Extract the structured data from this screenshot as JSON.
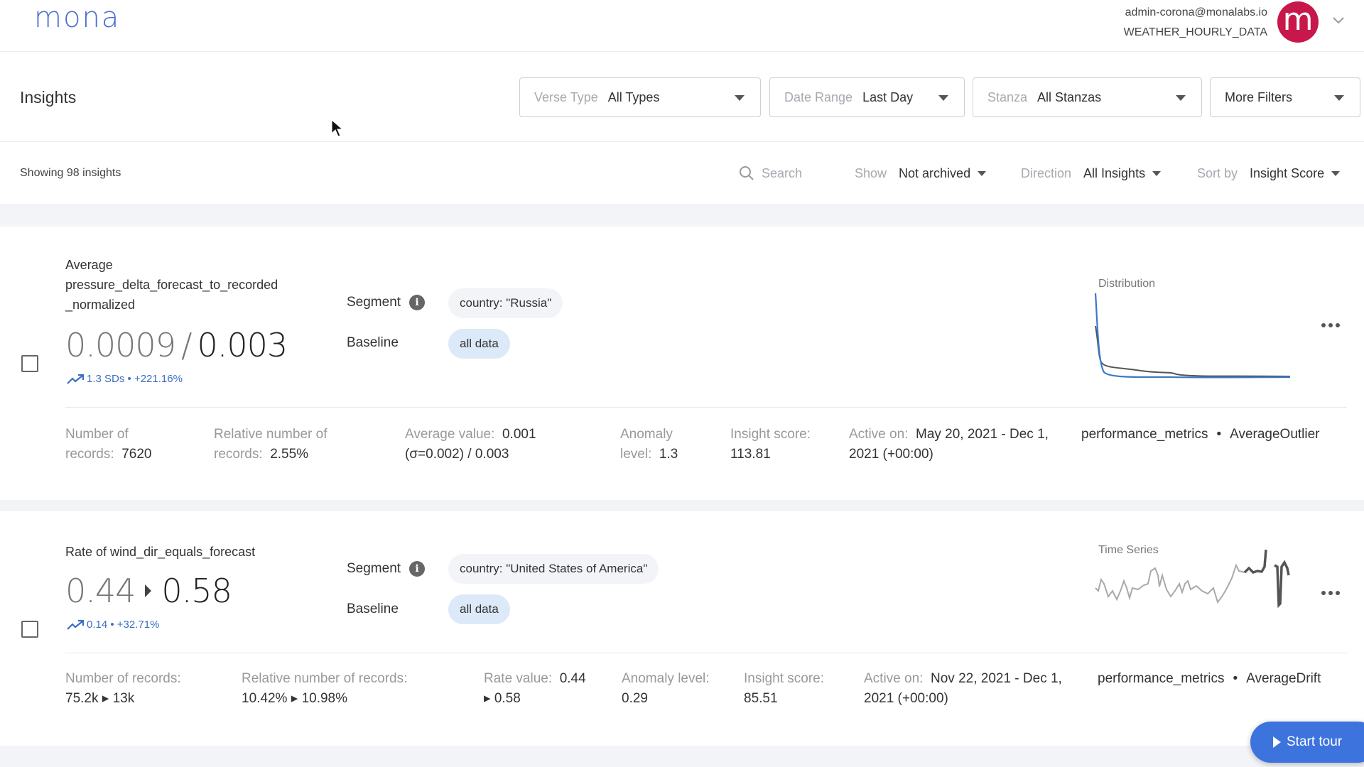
{
  "app": {
    "logo": "mona",
    "account_email": "admin-corona@monalabs.io",
    "account_context": "WEATHER_HOURLY_DATA",
    "avatar_letter": "m",
    "avatar_color": "#c8174a",
    "accent_color": "#3d73dd"
  },
  "header": {
    "title": "Insights",
    "filters": [
      {
        "label": "Verse Type",
        "value": "All Types"
      },
      {
        "label": "Date Range",
        "value": "Last Day"
      },
      {
        "label": "Stanza",
        "value": "All Stanzas"
      },
      {
        "label": "",
        "value": "More Filters"
      }
    ]
  },
  "toolbar": {
    "showing": "Showing 98 insights",
    "search_placeholder": "Search",
    "show": {
      "label": "Show",
      "value": "Not archived"
    },
    "direction": {
      "label": "Direction",
      "value": "All Insights"
    },
    "sort": {
      "label": "Sort by",
      "value": "Insight Score"
    }
  },
  "insights": [
    {
      "title_line1": "Average",
      "title_line2": "pressure_delta_forecast_to_recorded",
      "title_line3": "_normalized",
      "value_segment": "0.0009",
      "value_separator": "/",
      "value_baseline": "0.003",
      "delta": "1.3 SDs • +221.16%",
      "segment_label": "Segment",
      "segment_value": "country: \"Russia\"",
      "baseline_label": "Baseline",
      "baseline_value": "all data",
      "chart_label": "Distribution",
      "stats": [
        {
          "label_a": "Number of",
          "label_b": "records:",
          "value": "7620"
        },
        {
          "label_a": "Relative number of",
          "label_b": "records:",
          "value": "2.55%"
        },
        {
          "label_a": "Average value:",
          "value_a": "0.001",
          "value_b": "(σ=0.002) / 0.003"
        },
        {
          "label_a": "Anomaly",
          "label_b": "level:",
          "value": "1.3"
        },
        {
          "label_a": "Insight score:",
          "value": "113.81"
        },
        {
          "label_a": "Active on:",
          "value_a": "May 20, 2021 - Dec 1,",
          "value_b": "2021 (+00:00)"
        }
      ],
      "tag_category": "performance_metrics",
      "tag_type": "AverageOutlier"
    },
    {
      "title_line1": "Rate of wind_dir_equals_forecast",
      "value_segment": "0.44",
      "value_baseline": "0.58",
      "delta": "0.14 • +32.71%",
      "segment_label": "Segment",
      "segment_value": "country: \"United States of America\"",
      "baseline_label": "Baseline",
      "baseline_value": "all data",
      "chart_label": "Time Series",
      "stats": [
        {
          "label_a": "Number of records:",
          "value_from": "75.2k",
          "value_to": "13k"
        },
        {
          "label_a": "Relative number of records:",
          "value_from": "10.42%",
          "value_to": "10.98%"
        },
        {
          "label_a": "Rate value:",
          "value_a": "0.44",
          "value_to": "0.58"
        },
        {
          "label_a": "Anomaly level:",
          "value": "0.29"
        },
        {
          "label_a": "Insight score:",
          "value": "85.51"
        },
        {
          "label_a": "Active on:",
          "value_a": "Nov 22, 2021 - Dec 1,",
          "value_b": "2021 (+00:00)"
        }
      ],
      "tag_category": "performance_metrics",
      "tag_type": "AverageDrift"
    }
  ],
  "tour_button": "Start tour"
}
